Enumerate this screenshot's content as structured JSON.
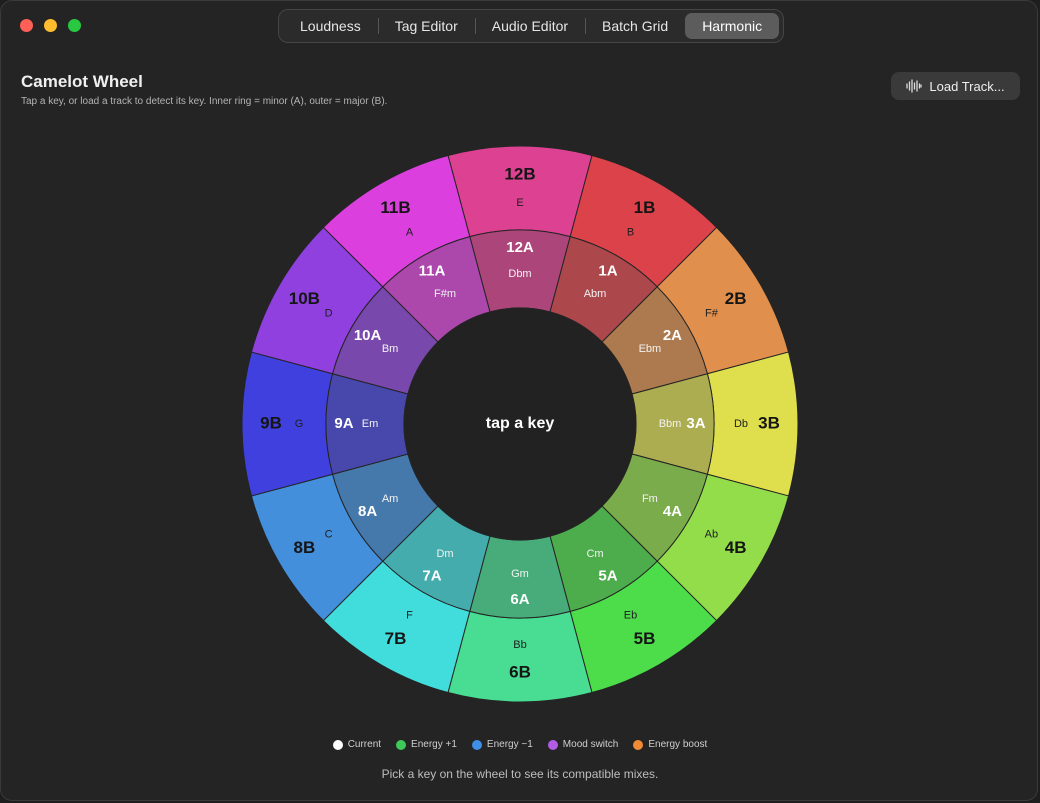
{
  "window": {
    "traffic_lights": [
      {
        "name": "close",
        "color": "#fe5f57"
      },
      {
        "name": "minimize",
        "color": "#febc2e"
      },
      {
        "name": "zoom",
        "color": "#28c840"
      }
    ]
  },
  "tabs": [
    {
      "label": "Loudness",
      "active": false
    },
    {
      "label": "Tag Editor",
      "active": false
    },
    {
      "label": "Audio Editor",
      "active": false
    },
    {
      "label": "Batch Grid",
      "active": false
    },
    {
      "label": "Harmonic",
      "active": true
    }
  ],
  "header": {
    "title": "Camelot Wheel",
    "subtitle": "Tap a key, or load a track to detect its key.  Inner ring = minor (A), outer = major (B).",
    "load_button": {
      "label": "Load Track...",
      "icon": "waveform-icon"
    }
  },
  "wheel": {
    "center_label": "tap a key",
    "outer": [
      {
        "code": "12B",
        "key": "E",
        "color": "#dc4291"
      },
      {
        "code": "1B",
        "key": "B",
        "color": "#dc4249"
      },
      {
        "code": "2B",
        "key": "F#",
        "color": "#e08f4d"
      },
      {
        "code": "3B",
        "key": "Db",
        "color": "#dfdf4e"
      },
      {
        "code": "4B",
        "key": "Ab",
        "color": "#93dd4a"
      },
      {
        "code": "5B",
        "key": "Eb",
        "color": "#4ddd4a"
      },
      {
        "code": "6B",
        "key": "Bb",
        "color": "#48dd93"
      },
      {
        "code": "7B",
        "key": "F",
        "color": "#41dddd"
      },
      {
        "code": "8B",
        "key": "C",
        "color": "#438fdb"
      },
      {
        "code": "9B",
        "key": "G",
        "color": "#4040df"
      },
      {
        "code": "10B",
        "key": "D",
        "color": "#8f40df"
      },
      {
        "code": "11B",
        "key": "A",
        "color": "#db40de"
      }
    ],
    "inner": [
      {
        "code": "12A",
        "key": "Dbm",
        "color": "#ac4579"
      },
      {
        "code": "1A",
        "key": "Abm",
        "color": "#ac474c"
      },
      {
        "code": "2A",
        "key": "Ebm",
        "color": "#ac7a4e"
      },
      {
        "code": "3A",
        "key": "Bbm",
        "color": "#acac50"
      },
      {
        "code": "4A",
        "key": "Fm",
        "color": "#7bac4c"
      },
      {
        "code": "5A",
        "key": "Cm",
        "color": "#4dac4c"
      },
      {
        "code": "6A",
        "key": "Gm",
        "color": "#48ac7a"
      },
      {
        "code": "7A",
        "key": "Dm",
        "color": "#44acac"
      },
      {
        "code": "8A",
        "key": "Am",
        "color": "#4579ac"
      },
      {
        "code": "9A",
        "key": "Em",
        "color": "#4747ac"
      },
      {
        "code": "10A",
        "key": "Bm",
        "color": "#7948ac"
      },
      {
        "code": "11A",
        "key": "F#m",
        "color": "#ac48ab"
      }
    ]
  },
  "legend": [
    {
      "label": "Current",
      "color": "#ffffff"
    },
    {
      "label": "Energy +1",
      "color": "#3fc85a"
    },
    {
      "label": "Energy −1",
      "color": "#3f8fe8"
    },
    {
      "label": "Mood switch",
      "color": "#b25ce6"
    },
    {
      "label": "Energy boost",
      "color": "#f08a34"
    }
  ],
  "hint": "Pick a key on the wheel to see its compatible mixes."
}
